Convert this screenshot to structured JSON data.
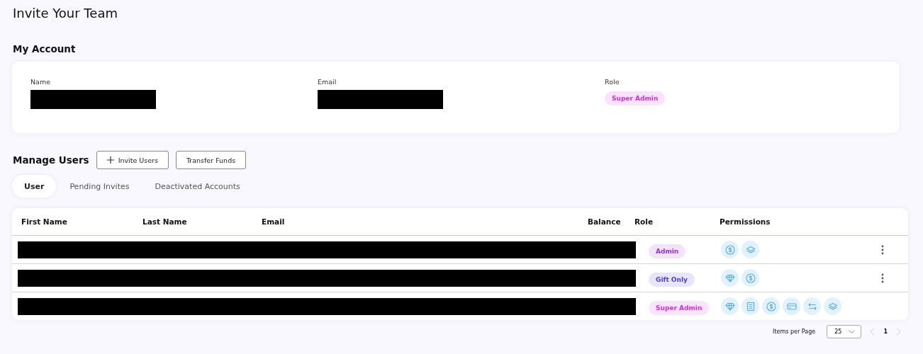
{
  "page_title": "Invite Your Team",
  "my_account": {
    "heading": "My Account",
    "fields": [
      {
        "label": "Name",
        "kind": "redacted"
      },
      {
        "label": "Email",
        "kind": "redacted"
      },
      {
        "label": "Role",
        "kind": "badge",
        "value": "Super Admin",
        "color": "#d62fe6"
      }
    ]
  },
  "manage_users": {
    "heading": "Manage Users",
    "buttons": [
      {
        "label": "Invite Users",
        "kind": "add"
      },
      {
        "label": "Transfer Funds",
        "kind": "plain"
      }
    ]
  },
  "tabs": [
    {
      "label": "User",
      "selected": true
    },
    {
      "label": "Pending Invites",
      "selected": false
    },
    {
      "label": "Deactivated Accounts",
      "selected": false
    }
  ],
  "table": {
    "columns": [
      "First Name",
      "Last Name",
      "Email",
      "Balance",
      "Role",
      "Permissions"
    ],
    "rows": [
      {
        "role": "Admin",
        "color": "#9b2fe0",
        "permissions": [
          {
            "kind": "dollar"
          },
          {
            "kind": "layers"
          }
        ],
        "menu": true
      },
      {
        "role": "Gift Only",
        "color": "#4a3de0",
        "permissions": [
          {
            "kind": "diamond"
          },
          {
            "kind": "dollar"
          }
        ],
        "menu": true
      },
      {
        "role": "Super Admin",
        "color": "#d62fe6",
        "permissions": [
          {
            "kind": "diamond"
          },
          {
            "kind": "document"
          },
          {
            "kind": "dollar"
          },
          {
            "kind": "card"
          },
          {
            "kind": "transfer"
          },
          {
            "kind": "layers"
          }
        ],
        "menu": false
      }
    ]
  },
  "pagination": {
    "label": "Items per Page",
    "page_size": "25",
    "page": "1",
    "prev_disabled": true,
    "next_disabled": true
  }
}
